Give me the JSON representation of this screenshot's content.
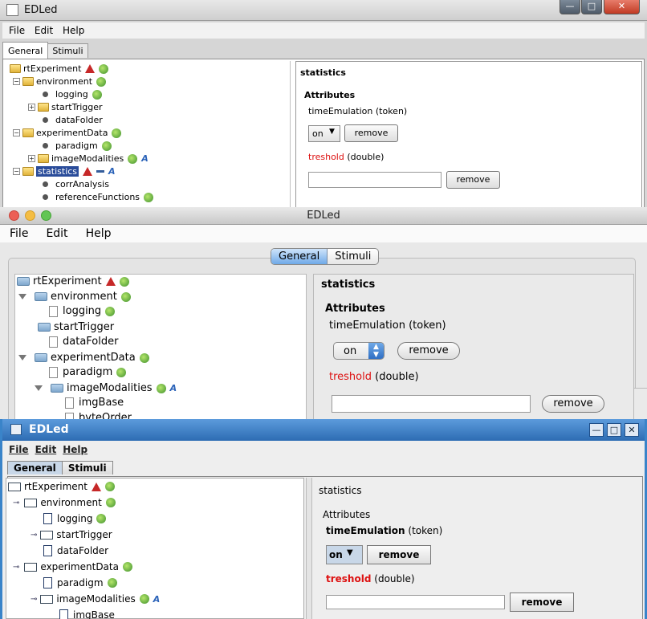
{
  "app_title": "EDLed",
  "menu": [
    "File",
    "Edit",
    "Help"
  ],
  "tabs": {
    "general": "General",
    "stimuli": "Stimuli"
  },
  "tree_nodes": {
    "rtExperiment": "rtExperiment",
    "environment": "environment",
    "logging": "logging",
    "startTrigger": "startTrigger",
    "dataFolder": "dataFolder",
    "experimentData": "experimentData",
    "paradigm": "paradigm",
    "imageModalities": "imageModalities",
    "statistics": "statistics",
    "corrAnalysis": "corrAnalysis",
    "referenceFunctions": "referenceFunctions",
    "imgBase": "imgBase",
    "byteOrder": "byteOrder"
  },
  "detail": {
    "node_title": "statistics",
    "attributes_label": "Attributes",
    "attr1_name": "timeEmulation",
    "attr1_type": "(token)",
    "attr1_value": "on",
    "attr2_name": "treshold",
    "attr2_type": "(double)",
    "attr2_value": "",
    "remove": "remove"
  },
  "window_controls": {
    "minimize": "—",
    "maximize": "□",
    "close": "✕"
  },
  "icons": {
    "warning": "warning-icon",
    "add": "add-child-icon",
    "remove": "remove-icon",
    "attribute": "attribute-icon",
    "folder": "folder-icon",
    "file": "file-icon"
  },
  "colors": {
    "required_attr": "#d11111",
    "selection": "#2a4c9a",
    "metal_titlebar": "#3a84c9"
  }
}
